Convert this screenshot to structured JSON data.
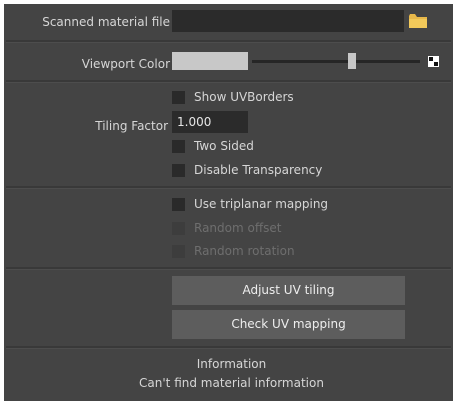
{
  "scanned_material": {
    "label": "Scanned material file",
    "value": "",
    "browse_icon": "folder-icon"
  },
  "viewport_color": {
    "label": "Viewport Color",
    "swatch_color": "#c8c8c8",
    "slider_level": 0.8,
    "checker_icon": "checkerboard-icon"
  },
  "tiling": {
    "show_uv_borders": {
      "label": "Show UVBorders",
      "checked": false
    },
    "label": "Tiling Factor",
    "value": "1.000",
    "two_sided": {
      "label": "Two Sided",
      "checked": false
    },
    "disable_transparency": {
      "label": "Disable Transparency",
      "checked": false
    }
  },
  "triplanar": {
    "use_triplanar": {
      "label": "Use triplanar mapping",
      "checked": false
    },
    "random_offset": {
      "label": "Random offset",
      "checked": false,
      "enabled": false
    },
    "random_rotation": {
      "label": "Random rotation",
      "checked": false,
      "enabled": false
    }
  },
  "buttons": {
    "adjust_uv_tiling": "Adjust UV tiling",
    "check_uv_mapping": "Check UV mapping"
  },
  "information": {
    "title": "Information",
    "message": "Can't find material information"
  },
  "colors": {
    "panel_bg": "#444444",
    "field_bg": "#2b2b2b",
    "button_bg": "#5d5d5d",
    "folder": "#e8b84a"
  }
}
